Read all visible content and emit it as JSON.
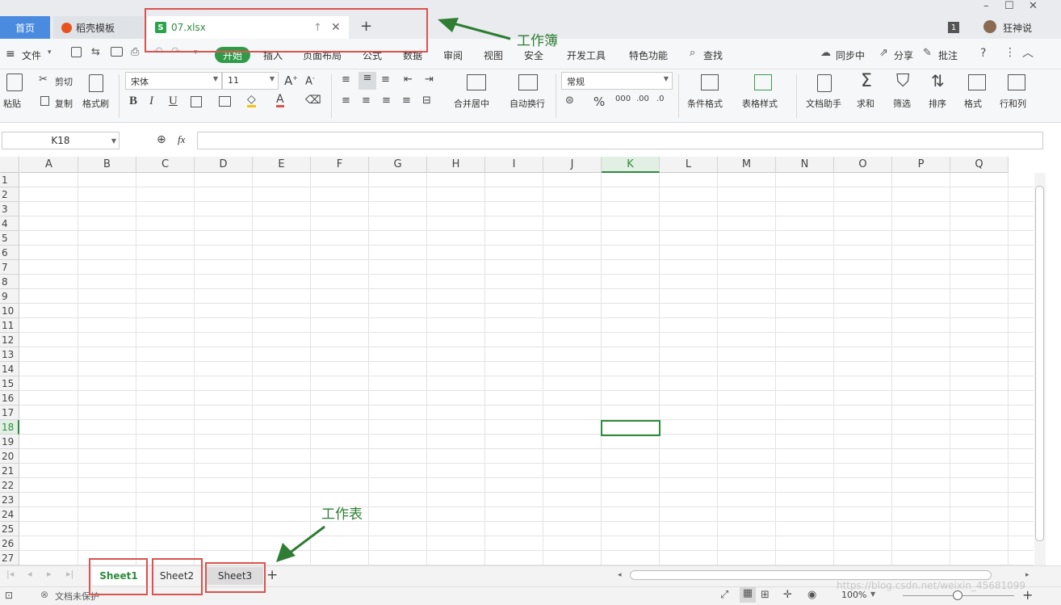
{
  "titlebar": {
    "home_tab": "首页",
    "template_tab": "稻壳模板",
    "doc_tab": "07.xlsx",
    "doc_icon": "S",
    "new_tab": "+",
    "page_badge": "1",
    "user_name": "狂神说",
    "win_minimize": "–",
    "win_maximize": "☐",
    "win_close": "✕"
  },
  "menubar": {
    "file": "文件",
    "items": [
      "开始",
      "插入",
      "页面布局",
      "公式",
      "数据",
      "审阅",
      "视图",
      "安全",
      "开发工具",
      "特色功能"
    ],
    "search": "查找",
    "sync": "同步中",
    "share": "分享",
    "comment": "批注"
  },
  "ribbon": {
    "paste": "粘贴",
    "cut": "剪切",
    "copy": "复制",
    "format_painter": "格式刷",
    "font_name": "宋体",
    "font_size": "11",
    "bold": "B",
    "italic": "I",
    "underline": "U",
    "merge_center": "合并居中",
    "wrap_text": "自动换行",
    "number_format": "常规",
    "percent": "%",
    "cond_format": "条件格式",
    "table_style": "表格样式",
    "doc_assistant": "文档助手",
    "sum": "求和",
    "filter": "筛选",
    "sort": "排序",
    "format": "格式",
    "row_col": "行和列"
  },
  "formula_bar": {
    "name_box": "K18",
    "fx": "fx",
    "formula": ""
  },
  "grid": {
    "columns": [
      "A",
      "B",
      "C",
      "D",
      "E",
      "F",
      "G",
      "H",
      "I",
      "J",
      "K",
      "L",
      "M",
      "N",
      "O",
      "P",
      "Q"
    ],
    "rows": [
      "1",
      "2",
      "3",
      "4",
      "5",
      "6",
      "7",
      "8",
      "9",
      "10",
      "11",
      "12",
      "13",
      "14",
      "15",
      "16",
      "17",
      "18",
      "19",
      "20",
      "21",
      "22",
      "23",
      "24",
      "25",
      "26",
      "27"
    ],
    "selected_column": "K",
    "selected_row": "18"
  },
  "sheet_tabs": {
    "tabs": [
      "Sheet1",
      "Sheet2",
      "Sheet3"
    ],
    "active": "Sheet1",
    "add": "+"
  },
  "statusbar": {
    "protect": "文档未保护",
    "zoom": "100%",
    "watermark": "https://blog.csdn.net/weixin_45681099"
  },
  "annotations": {
    "workbook": "工作簿",
    "worksheet": "工作表",
    "color": "#2e7d32",
    "box_color": "#d9534f"
  }
}
